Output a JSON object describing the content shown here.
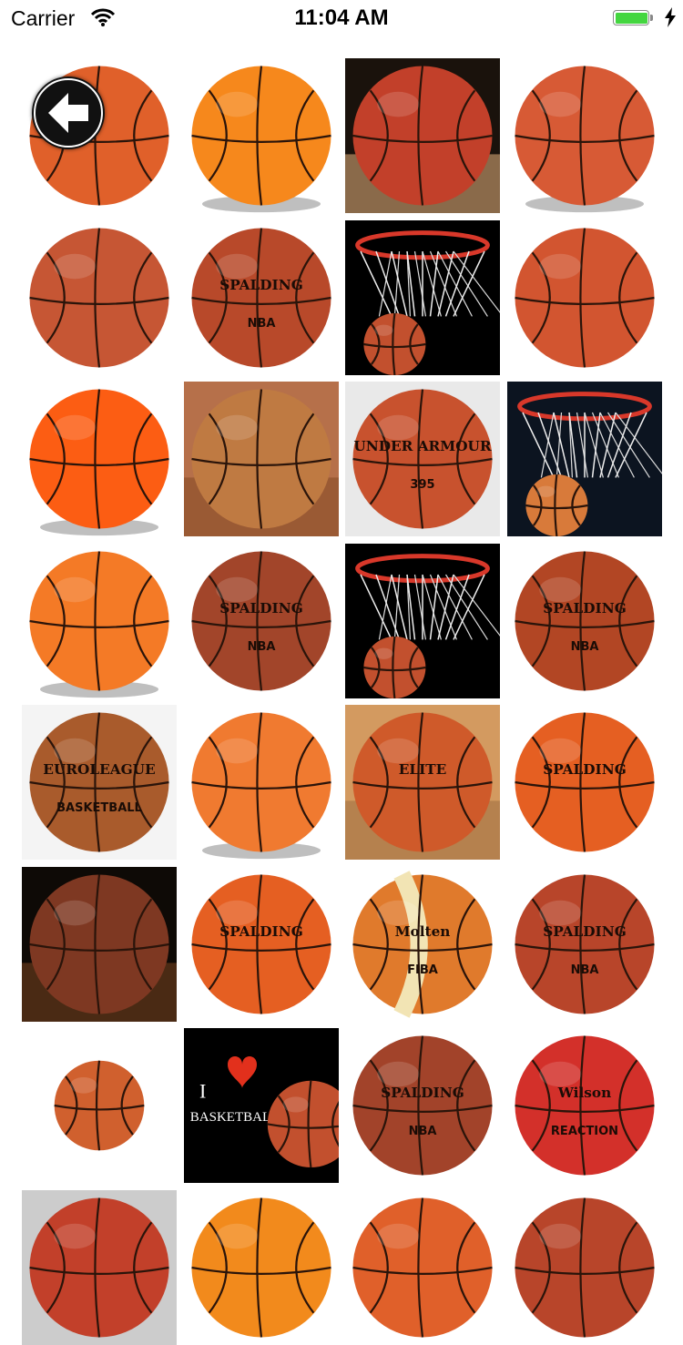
{
  "status_bar": {
    "carrier": "Carrier",
    "time": "11:04 AM",
    "battery_level": 1.0,
    "battery_color": "#44d640"
  },
  "back_button": {
    "icon": "arrow-left-icon"
  },
  "images": [
    {
      "type": "ball",
      "bg": "#ffffff",
      "ball": "#e0602a"
    },
    {
      "type": "ball",
      "bg": "#ffffff",
      "ball": "#f6881c",
      "shadow": true
    },
    {
      "type": "ball",
      "bg": "#1a120c",
      "ball": "#c2402a",
      "floor": "#8a6a4a"
    },
    {
      "type": "ball",
      "bg": "#ffffff",
      "ball": "#d75a35",
      "shadow": true
    },
    {
      "type": "ball",
      "bg": "#ffffff",
      "ball": "#c65634"
    },
    {
      "type": "ball",
      "bg": "#ffffff",
      "ball": "#b8492a",
      "label": "SPALDING",
      "sublabel": "NBA"
    },
    {
      "type": "hoop",
      "bg": "#000000",
      "ball": "#c2502e"
    },
    {
      "type": "ball",
      "bg": "#ffffff",
      "ball": "#d25530"
    },
    {
      "type": "ball",
      "bg": "#ffffff",
      "ball": "#fc5d13",
      "shadow": true
    },
    {
      "type": "ball",
      "bg": "#b6704a",
      "ball": "#bf7a42",
      "floor": "#9a5a34"
    },
    {
      "type": "ball",
      "bg": "#e9e9e9",
      "ball": "#c8522e",
      "label": "UNDER ARMOUR",
      "sublabel": "395"
    },
    {
      "type": "hoop",
      "bg": "#0c1420",
      "ball": "#d87a3a"
    },
    {
      "type": "ball",
      "bg": "#ffffff",
      "ball": "#f47a26",
      "shadow": true
    },
    {
      "type": "ball",
      "bg": "#ffffff",
      "ball": "#a2452a",
      "label": "SPALDING",
      "sublabel": "NBA"
    },
    {
      "type": "hoop",
      "bg": "#000000",
      "ball": "#c2502e"
    },
    {
      "type": "ball",
      "bg": "#ffffff",
      "ball": "#b24624",
      "label": "SPALDING",
      "sublabel": "NBA"
    },
    {
      "type": "ball",
      "bg": "#f4f4f4",
      "ball": "#a95b2c",
      "label": "EUROLEAGUE",
      "sublabel": "BASKETBALL"
    },
    {
      "type": "ball",
      "bg": "#ffffff",
      "ball": "#f07a30",
      "shadow": true
    },
    {
      "type": "ball",
      "bg": "#d39a60",
      "ball": "#cf5a2a",
      "floor": "#b5814e",
      "label": "ELITE"
    },
    {
      "type": "ball",
      "bg": "#ffffff",
      "ball": "#e55f22",
      "label": "SPALDING"
    },
    {
      "type": "ball",
      "bg": "#0e0a06",
      "ball": "#7e3822",
      "floor": "#4a2a14"
    },
    {
      "type": "ball",
      "bg": "#ffffff",
      "ball": "#e55f22",
      "label": "SPALDING"
    },
    {
      "type": "ball",
      "bg": "#ffffff",
      "ball": "#e07a2c",
      "label": "Molten",
      "sublabel": "FIBA",
      "stripes": "#f2e4b4"
    },
    {
      "type": "ball",
      "bg": "#ffffff",
      "ball": "#b8452a",
      "label": "SPALDING",
      "sublabel": "NBA"
    },
    {
      "type": "ball",
      "bg": "#ffffff",
      "ball": "#d0602e",
      "small": true
    },
    {
      "type": "love",
      "bg": "#000000",
      "ball": "#c2502e",
      "label": "I",
      "sublabel": "BASKETBALL"
    },
    {
      "type": "ball",
      "bg": "#ffffff",
      "ball": "#a2432a",
      "label": "SPALDING",
      "sublabel": "NBA"
    },
    {
      "type": "ball",
      "bg": "#ffffff",
      "ball": "#d3302a",
      "label": "Wilson",
      "sublabel": "REACTION"
    },
    {
      "type": "ball",
      "bg": "#cccccc",
      "ball": "#c2402a"
    },
    {
      "type": "ball",
      "bg": "#ffffff",
      "ball": "#f28a1c"
    },
    {
      "type": "ball",
      "bg": "#ffffff",
      "ball": "#e0602a"
    },
    {
      "type": "ball",
      "bg": "#ffffff",
      "ball": "#b8452a"
    }
  ]
}
